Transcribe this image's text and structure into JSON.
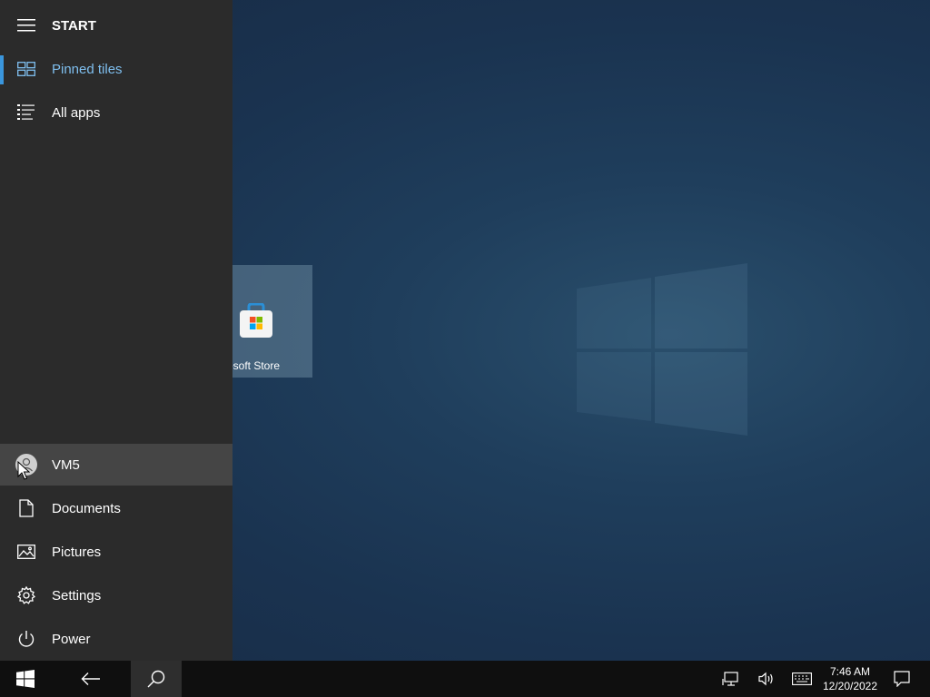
{
  "start_menu": {
    "header_label": "START",
    "nav": [
      {
        "label": "Pinned tiles",
        "icon": "pinned-tiles-icon",
        "selected": true
      },
      {
        "label": "All apps",
        "icon": "all-apps-list-icon",
        "selected": false
      }
    ],
    "bottom_items": [
      {
        "label": "VM5",
        "icon": "user-avatar-icon",
        "hovered": true
      },
      {
        "label": "Documents",
        "icon": "document-icon"
      },
      {
        "label": "Pictures",
        "icon": "pictures-icon"
      },
      {
        "label": "Settings",
        "icon": "gear-icon"
      },
      {
        "label": "Power",
        "icon": "power-icon"
      }
    ]
  },
  "tiles": [
    {
      "label": "osoft Store",
      "icon": "store-bag-icon"
    }
  ],
  "taskbar": {
    "clock_time": "7:46 AM",
    "clock_date": "12/20/2022",
    "tray_icons": [
      "network-icon",
      "volume-icon",
      "keyboard-icon",
      "action-center-icon"
    ],
    "buttons": [
      "windows-start-icon",
      "back-arrow-icon",
      "search-icon"
    ]
  },
  "colors": {
    "accent": "#3a96dd",
    "selected_text": "#7fbfef",
    "panel_bg": "#2b2b2b",
    "hover_bg": "#454545",
    "taskbar_bg": "#0f0f0f"
  }
}
